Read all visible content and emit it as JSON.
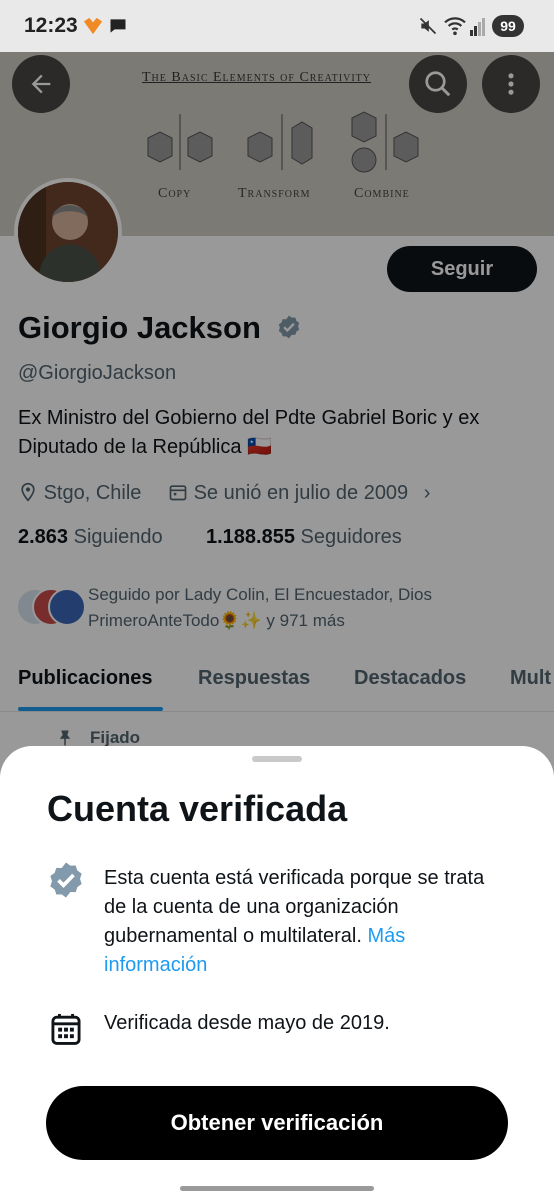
{
  "status_bar": {
    "time": "12:23",
    "battery": "99"
  },
  "banner": {
    "title": "The Basic Elements of Creativity",
    "captions": [
      "Copy",
      "Transform",
      "Combine"
    ]
  },
  "profile": {
    "follow_label": "Seguir",
    "name": "Giorgio Jackson",
    "handle": "@GiorgioJackson",
    "bio": "Ex Ministro del Gobierno del Pdte Gabriel Boric y ex Diputado de la República 🇨🇱",
    "location": "Stgo, Chile",
    "joined": "Se unió en julio de 2009",
    "following_count": "2.863",
    "following_label": "Siguiendo",
    "followers_count": "1.188.855",
    "followers_label": "Seguidores",
    "followed_by": "Seguido por Lady Colin, El Encuestador, Dios PrimeroAnteTodo🌻✨ y 971 más"
  },
  "tabs": [
    "Publicaciones",
    "Respuestas",
    "Destacados",
    "Mult"
  ],
  "pinned_label": "Fijado",
  "sheet": {
    "title": "Cuenta verificada",
    "description": "Esta cuenta está verificada porque se trata de la cuenta de una organización gubernamental o multilateral.",
    "link_text": "Más información",
    "verified_since": "Verificada desde mayo de 2019.",
    "cta_label": "Obtener verificación"
  },
  "colors": {
    "accent": "#1d9bf0",
    "verified_badge": "#829aab",
    "text": "#0f1419"
  }
}
